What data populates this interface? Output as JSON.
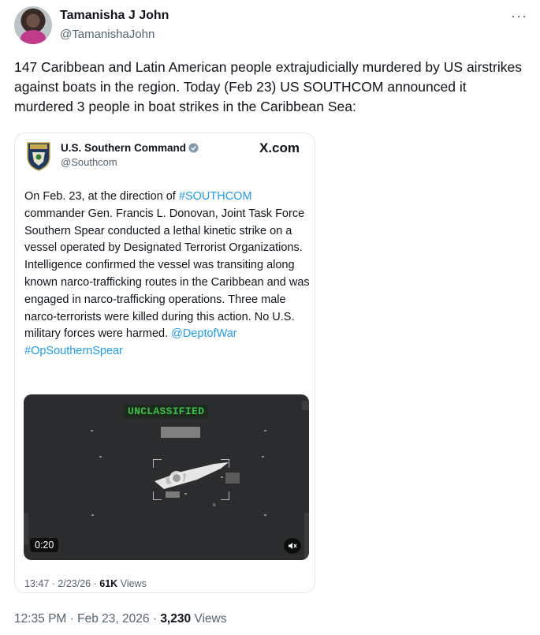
{
  "author": {
    "name": "Tamanisha J John",
    "handle": "@TamanishaJohn",
    "avatar_icon": "profile-photo"
  },
  "more_icon": "more-dots-icon",
  "tweet": {
    "text": "147 Caribbean and Latin American people extrajudicially murdered by US airstrikes against boats in the region. Today (Feb 23) US SOUTHCOM announced it murdered 3 people in boat strikes in the Caribbean Sea:",
    "time": "12:35 PM",
    "date": "Feb 23, 2026",
    "views_count": "3,230",
    "views_label": "Views",
    "separator": "·"
  },
  "quote": {
    "name": "U.S. Southern Command",
    "handle": "@Southcom",
    "source": "X.com",
    "verified_icon": "verified-badge-icon",
    "avatar_icon": "southcom-seal-icon",
    "text_parts": {
      "p1": "On Feb. 23, at the direction of ",
      "link1": "#SOUTHCOM",
      "p2": " commander Gen. Francis L. Donovan, Joint Task Force Southern Spear conducted a lethal kinetic strike on a vessel operated by Designated Terrorist Organizations. Intelligence confirmed the vessel was transiting along known narco-trafficking routes in the Caribbean and was engaged in narco-trafficking operations. Three male narco-terrorists were killed during this action. No U.S. military forces were harmed. ",
      "link2": "@DeptofWar",
      "link3": "#OpSouthernSpear"
    },
    "video": {
      "overlay_label": "UNCLASSIFIED",
      "duration": "0:20",
      "mute_icon": "speaker-muted-icon",
      "marker": "N"
    },
    "meta": {
      "time": "13:47",
      "date": "2/23/26",
      "views_count": "61K",
      "views_label": "Views",
      "separator": "·"
    }
  }
}
